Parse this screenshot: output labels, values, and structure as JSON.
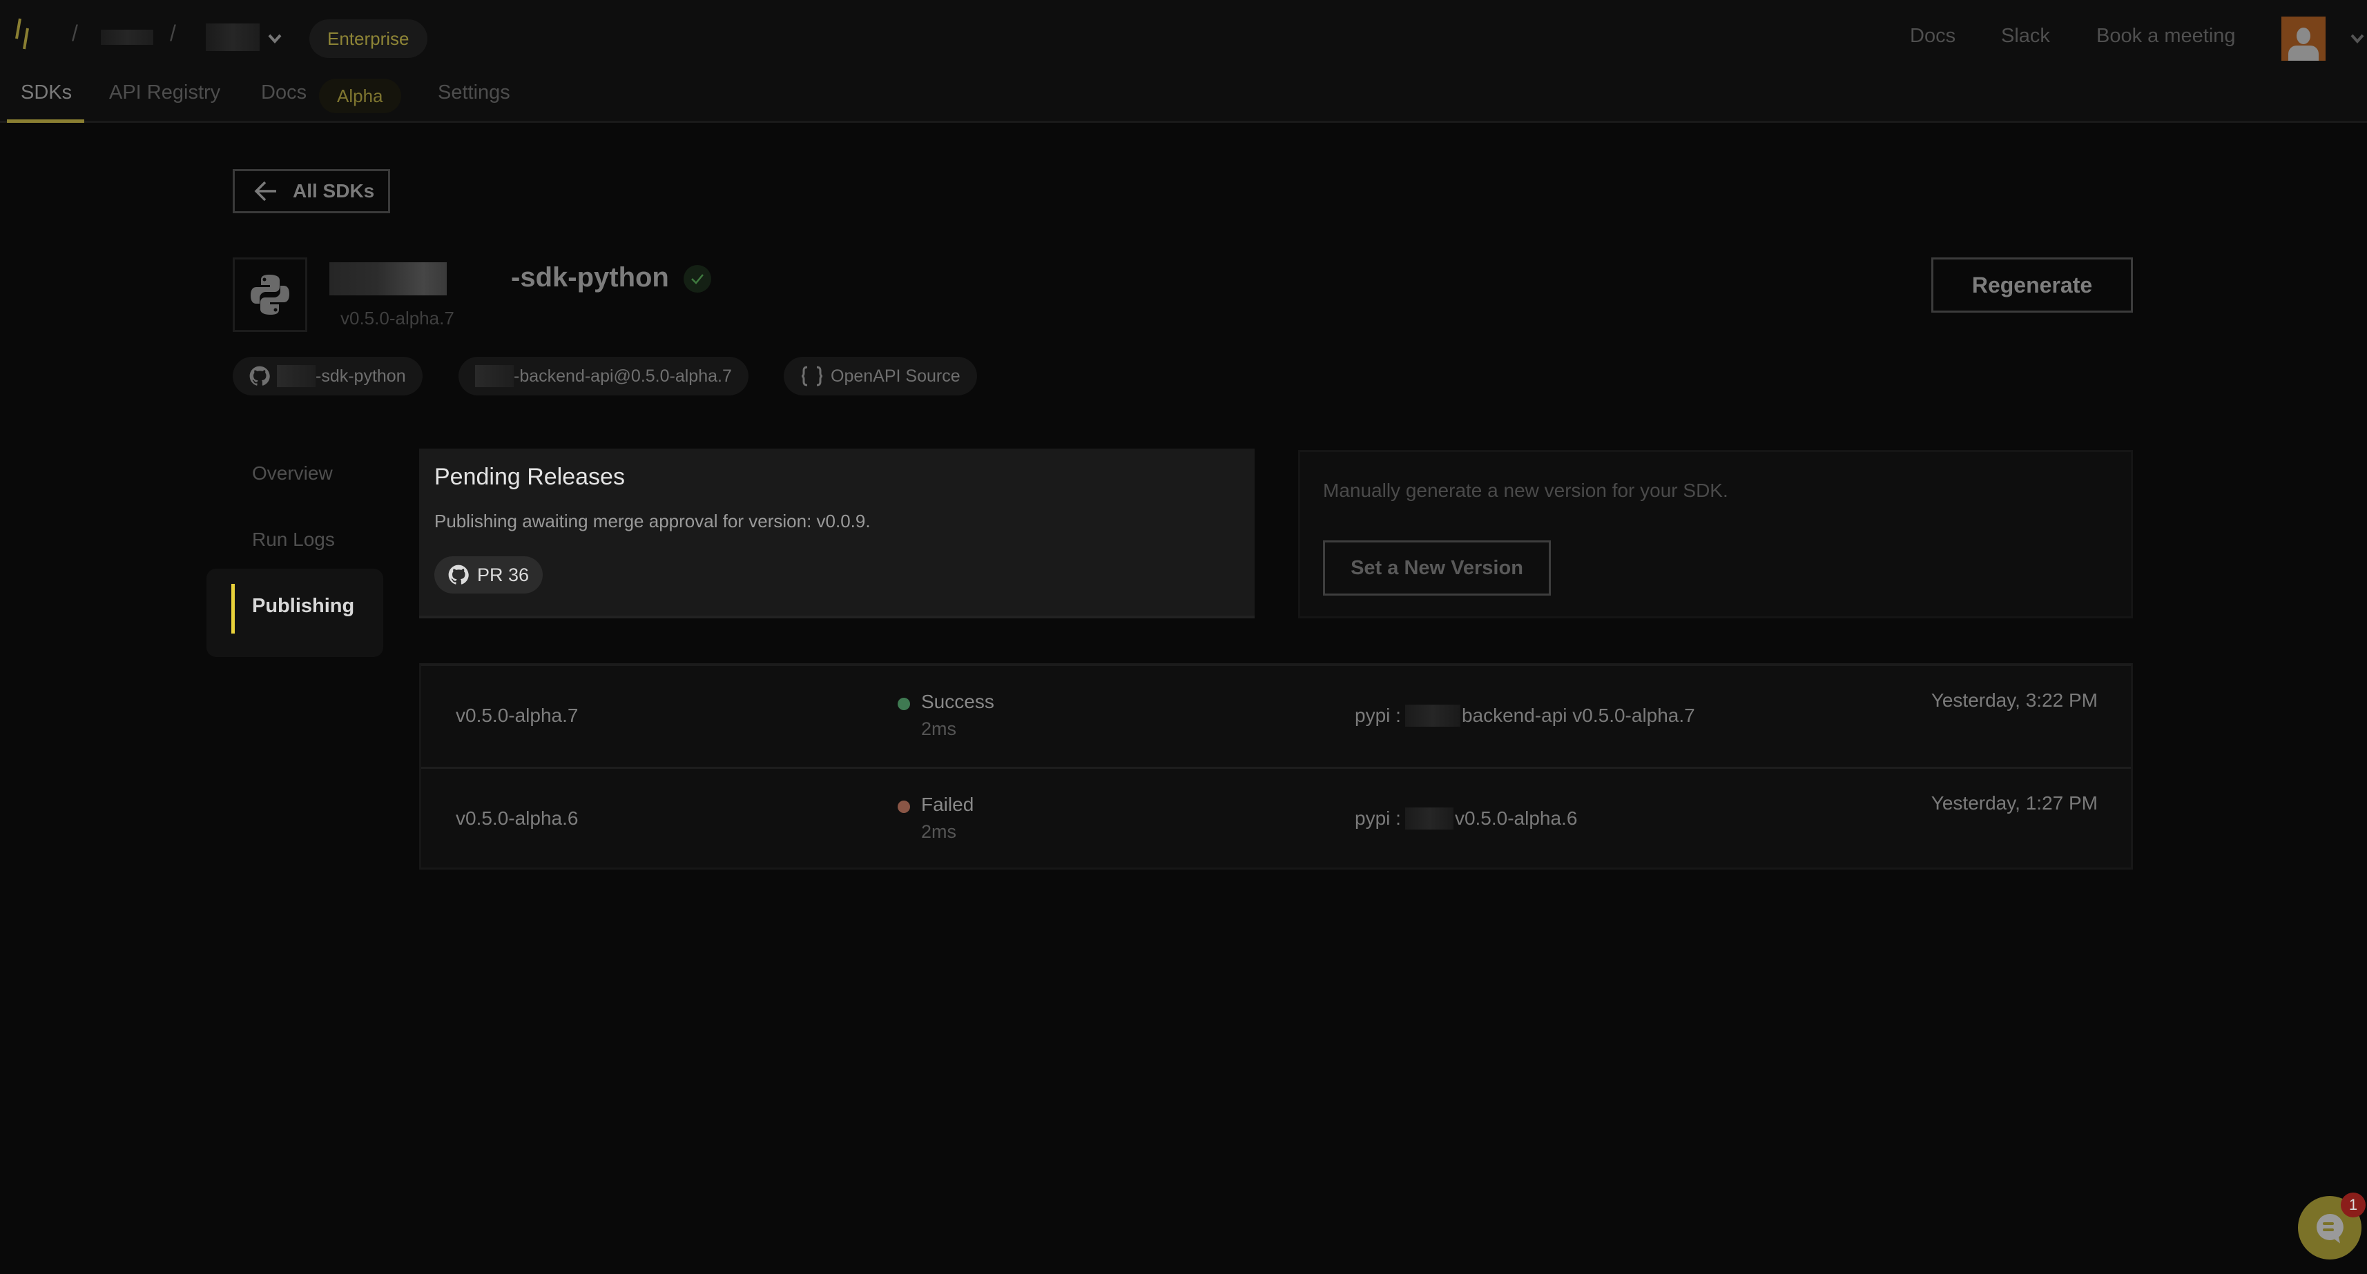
{
  "topbar": {
    "plan_badge": "Enterprise",
    "links": [
      "Docs",
      "Slack",
      "Book a meeting"
    ]
  },
  "tabs": [
    {
      "label": "SDKs",
      "active": true
    },
    {
      "label": "API Registry",
      "active": false
    },
    {
      "label": "Docs",
      "active": false,
      "badge": "Alpha"
    },
    {
      "label": "Settings",
      "active": false
    }
  ],
  "back_button": {
    "label": "All SDKs",
    "icon": "arrow-left-icon"
  },
  "sdk": {
    "name_suffix": "-sdk-python",
    "version": "v0.5.0-alpha.7",
    "verified": true,
    "language_icon": "python-icon",
    "chips": [
      {
        "icon": "github-icon",
        "label": "-sdk-python"
      },
      {
        "icon": "",
        "label": "-backend-api@0.5.0-alpha.7"
      },
      {
        "icon": "braces-icon",
        "label": "OpenAPI Source"
      }
    ]
  },
  "regenerate_label": "Regenerate",
  "sidebar": {
    "items": [
      {
        "label": "Overview",
        "active": false
      },
      {
        "label": "Run Logs",
        "active": false
      },
      {
        "label": "Publishing",
        "active": true
      }
    ]
  },
  "pending": {
    "title": "Pending Releases",
    "description": "Publishing awaiting merge approval for version: v0.0.9.",
    "pr_label": "PR 36"
  },
  "manual": {
    "description": "Manually generate a new version for your SDK.",
    "button_label": "Set a New Version"
  },
  "releases": [
    {
      "version": "v0.5.0-alpha.7",
      "status": "Success",
      "status_color": "#3f7a52",
      "duration": "2ms",
      "registry": "pypi :",
      "package": "backend-api v0.5.0-alpha.7",
      "time": "Yesterday, 3:22 PM"
    },
    {
      "version": "v0.5.0-alpha.6",
      "status": "Failed",
      "status_color": "#8a5646",
      "duration": "2ms",
      "registry": "pypi :",
      "package": "v0.5.0-alpha.6",
      "time": "Yesterday, 1:27 PM"
    }
  ],
  "chat": {
    "unread_count": "1"
  },
  "colors": {
    "accent": "#8a7f32",
    "active_bar": "#e8d13a",
    "success": "#3f7a52",
    "failed": "#8a5646"
  }
}
